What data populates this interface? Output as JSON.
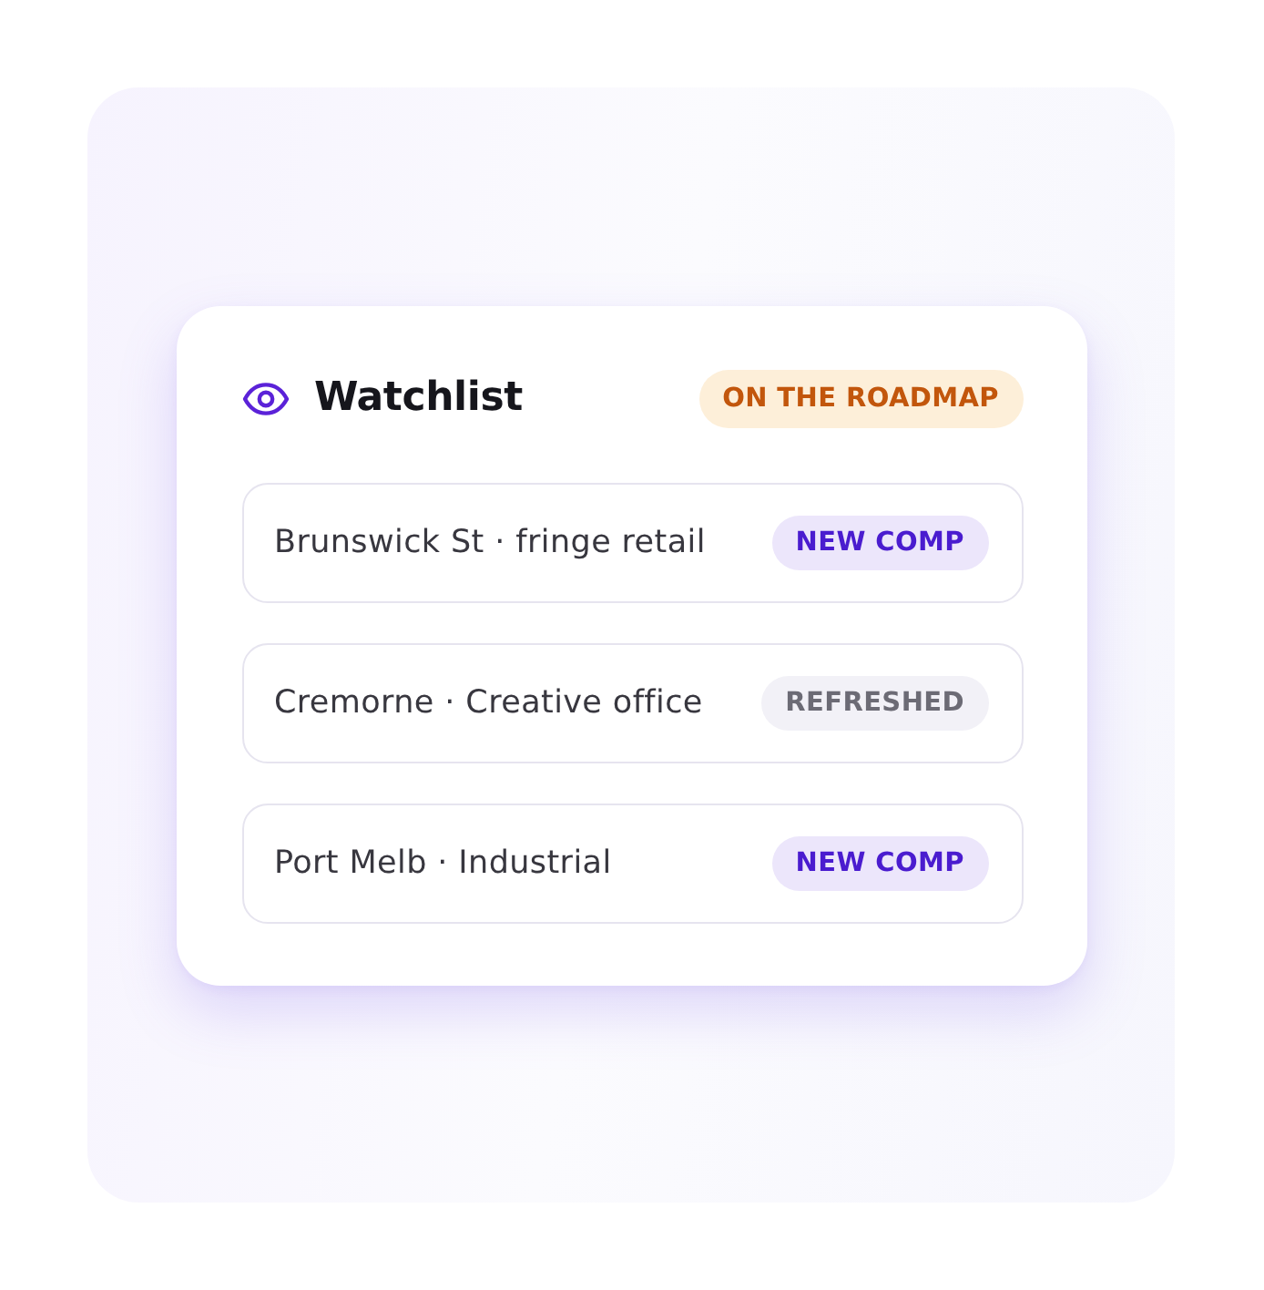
{
  "card": {
    "title": "Watchlist",
    "badge": "ON THE ROADMAP"
  },
  "items": [
    {
      "label": "Brunswick St · fringe retail",
      "status": {
        "text": "NEW COMP",
        "kind": "new"
      }
    },
    {
      "label": "Cremorne · Creative office",
      "status": {
        "text": "REFRESHED",
        "kind": "refreshed"
      }
    },
    {
      "label": "Port Melb · Industrial",
      "status": {
        "text": "NEW COMP",
        "kind": "new"
      }
    }
  ]
}
